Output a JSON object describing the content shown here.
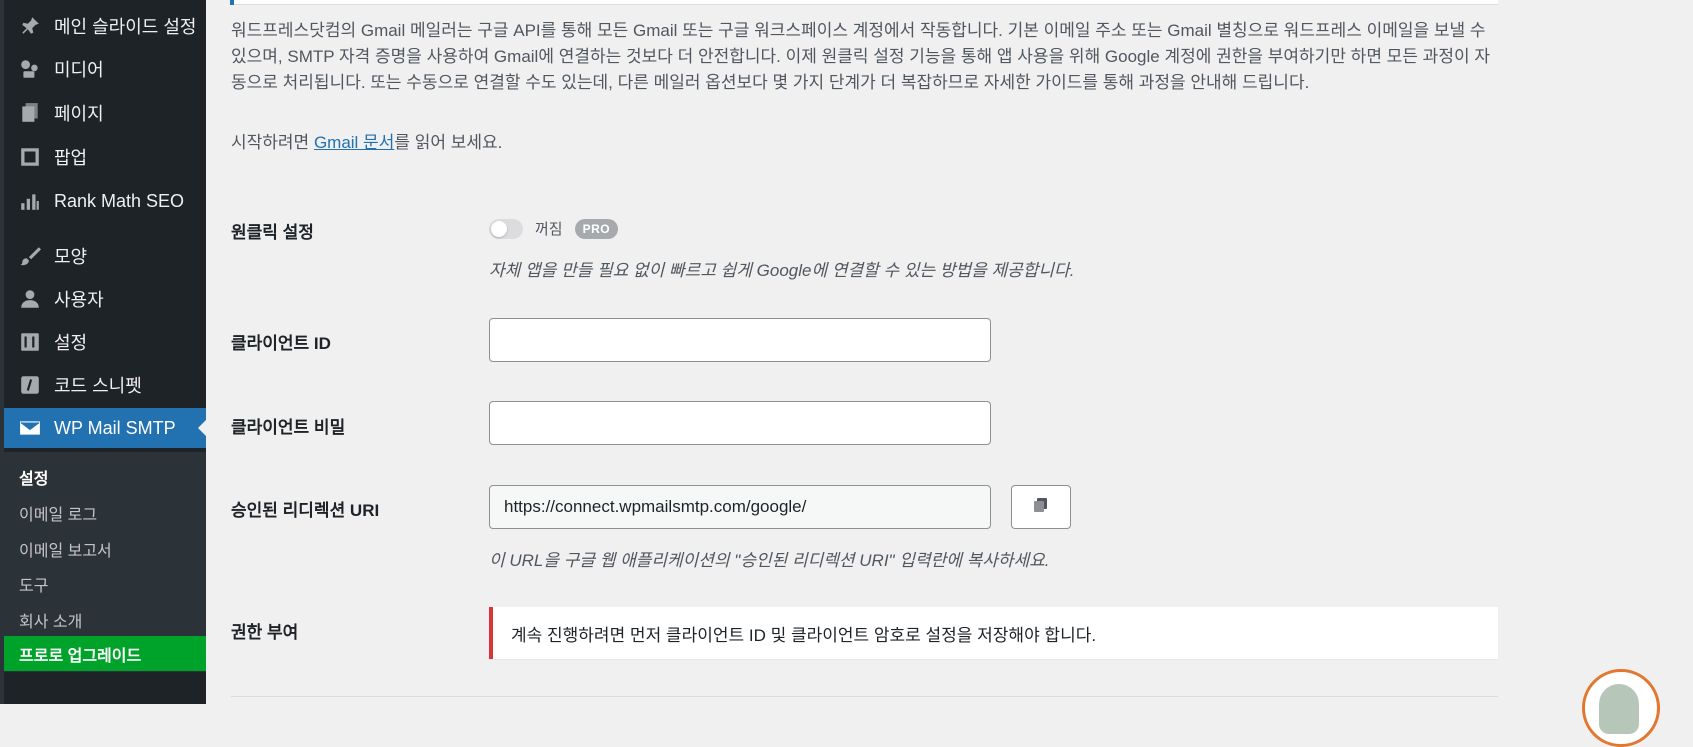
{
  "sidebar": {
    "items": [
      {
        "label": "메인 슬라이드 설정",
        "icon": "pin-icon"
      },
      {
        "label": "미디어",
        "icon": "media-icon"
      },
      {
        "label": "페이지",
        "icon": "pages-icon"
      },
      {
        "label": "팝업",
        "icon": "popup-icon"
      },
      {
        "label": "Rank Math SEO",
        "icon": "chart-icon"
      },
      {
        "label": "모양",
        "icon": "brush-icon"
      },
      {
        "label": "사용자",
        "icon": "user-icon"
      },
      {
        "label": "설정",
        "icon": "settings-icon"
      },
      {
        "label": "코드 스니펫",
        "icon": "code-icon"
      },
      {
        "label": "WP Mail SMTP",
        "icon": "mail-icon"
      }
    ],
    "submenu": [
      "설정",
      "이메일 로그",
      "이메일 보고서",
      "도구",
      "회사 소개"
    ],
    "pro_upgrade": "프로로 업그레이드",
    "active_color": "#2271b1",
    "upgrade_color": "#00a32a"
  },
  "main": {
    "description": "워드프레스닷컴의 Gmail 메일러는 구글 API를 통해 모든 Gmail 또는 구글 워크스페이스 계정에서 작동합니다. 기본 이메일 주소 또는 Gmail 별칭으로 워드프레스 이메일을 보낼 수 있으며, SMTP 자격 증명을 사용하여 Gmail에 연결하는 것보다 더 안전합니다. 이제 원클릭 설정 기능을 통해 앱 사용을 위해 Google 계정에 권한을 부여하기만 하면 모든 과정이 자동으로 처리됩니다. 또는 수동으로 연결할 수도 있는데, 다른 메일러 옵션보다 몇 가지 단계가 더 복잡하므로 자세한 가이드를 통해 과정을 안내해 드립니다.",
    "start_prefix": "시작하려면 ",
    "start_link": "Gmail 문서",
    "start_suffix": "를 읽어 보세요.",
    "one_click": {
      "label": "원클릭 설정",
      "toggle_state": "꺼짐",
      "badge": "PRO",
      "help": "자체 앱을 만들 필요 없이 빠르고 쉽게 Google에 연결할 수 있는 방법을 제공합니다."
    },
    "client_id": {
      "label": "클라이언트 ID",
      "value": ""
    },
    "client_secret": {
      "label": "클라이언트 비밀",
      "value": ""
    },
    "redirect_uri": {
      "label": "승인된 리디렉션 URI",
      "value": "https://connect.wpmailsmtp.com/google/",
      "help": "이 URL을 구글 웹 애플리케이션의 \"승인된 리디렉션 URI\" 입력란에 복사하세요."
    },
    "authorization": {
      "label": "권한 부여",
      "notice": "계속 진행하려면 먼저 클라이언트 ID 및 클라이언트 암호로 설정을 저장해야 합니다."
    }
  }
}
